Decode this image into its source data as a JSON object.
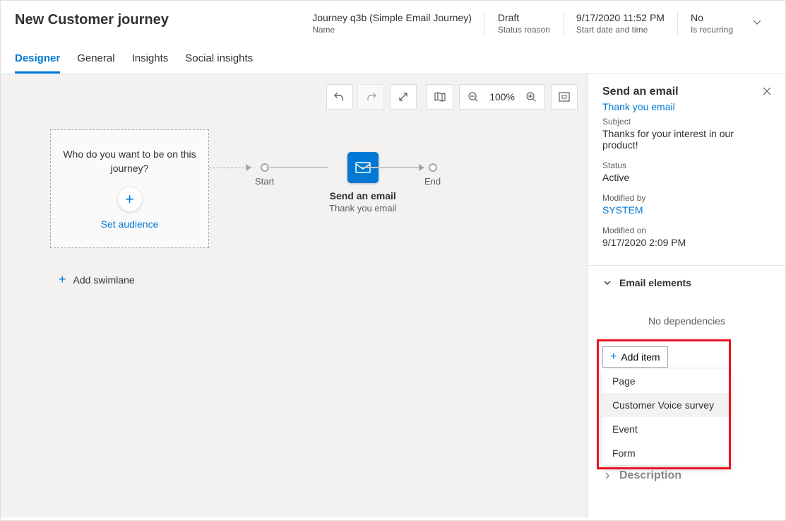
{
  "header": {
    "title": "New Customer journey",
    "fields": [
      {
        "value": "Journey q3b (Simple Email Journey)",
        "label": "Name"
      },
      {
        "value": "Draft",
        "label": "Status reason"
      },
      {
        "value": "9/17/2020 11:52 PM",
        "label": "Start date and time"
      },
      {
        "value": "No",
        "label": "Is recurring"
      }
    ]
  },
  "tabs": [
    "Designer",
    "General",
    "Insights",
    "Social insights"
  ],
  "toolbar": {
    "zoom": "100%"
  },
  "canvas": {
    "audience": {
      "question": "Who do you want to be on this journey?",
      "link": "Set audience"
    },
    "add_swimlane": "Add swimlane",
    "start": "Start",
    "end": "End",
    "email_tile": {
      "title": "Send an email",
      "subtitle": "Thank you email"
    }
  },
  "panel": {
    "title": "Send an email",
    "link": "Thank you email",
    "subject_label": "Subject",
    "subject_value": "Thanks for your interest in our product!",
    "status_label": "Status",
    "status_value": "Active",
    "modified_by_label": "Modified by",
    "modified_by_value": "SYSTEM",
    "modified_on_label": "Modified on",
    "modified_on_value": "9/17/2020 2:09 PM",
    "elements_title": "Email elements",
    "no_deps": "No dependencies",
    "add_item": "Add item",
    "dropdown": [
      "Page",
      "Customer Voice survey",
      "Event",
      "Form"
    ],
    "description": "Description"
  }
}
